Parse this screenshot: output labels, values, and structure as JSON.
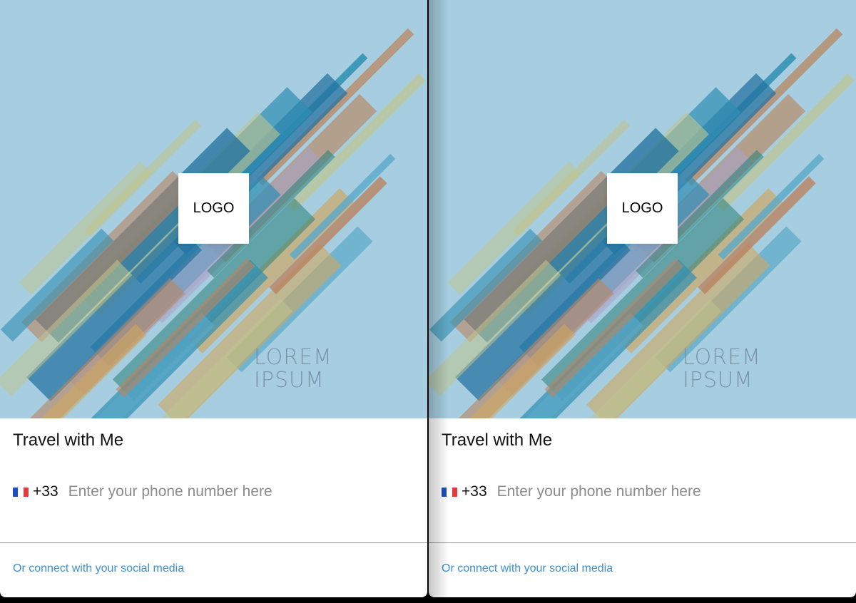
{
  "panels": [
    {
      "logo": "LOGO",
      "caption": {
        "line1": "LOREM",
        "line2": "IPSUM"
      },
      "title": "Travel with Me",
      "phone": {
        "country_flag": "flag-icon",
        "dial_code": "+33",
        "placeholder": "Enter your phone number here",
        "value": ""
      },
      "social_link": "Or connect with your social media"
    },
    {
      "logo": "LOGO",
      "caption": {
        "line1": "LOREM",
        "line2": "IPSUM"
      },
      "title": "Travel with Me",
      "phone": {
        "country_flag": "flag-icon",
        "dial_code": "+33",
        "placeholder": "Enter your phone number here",
        "value": ""
      },
      "social_link": "Or connect with your social media"
    }
  ],
  "colors": {
    "hero_background": "#a6cee0",
    "link": "#3b8fd0",
    "stripes": [
      "#2f8fb3",
      "#1f6f9e",
      "#b98560",
      "#c0c48e",
      "#a9a5c6",
      "#2a7f7a",
      "#d0a65d",
      "#5aa9c9"
    ]
  }
}
